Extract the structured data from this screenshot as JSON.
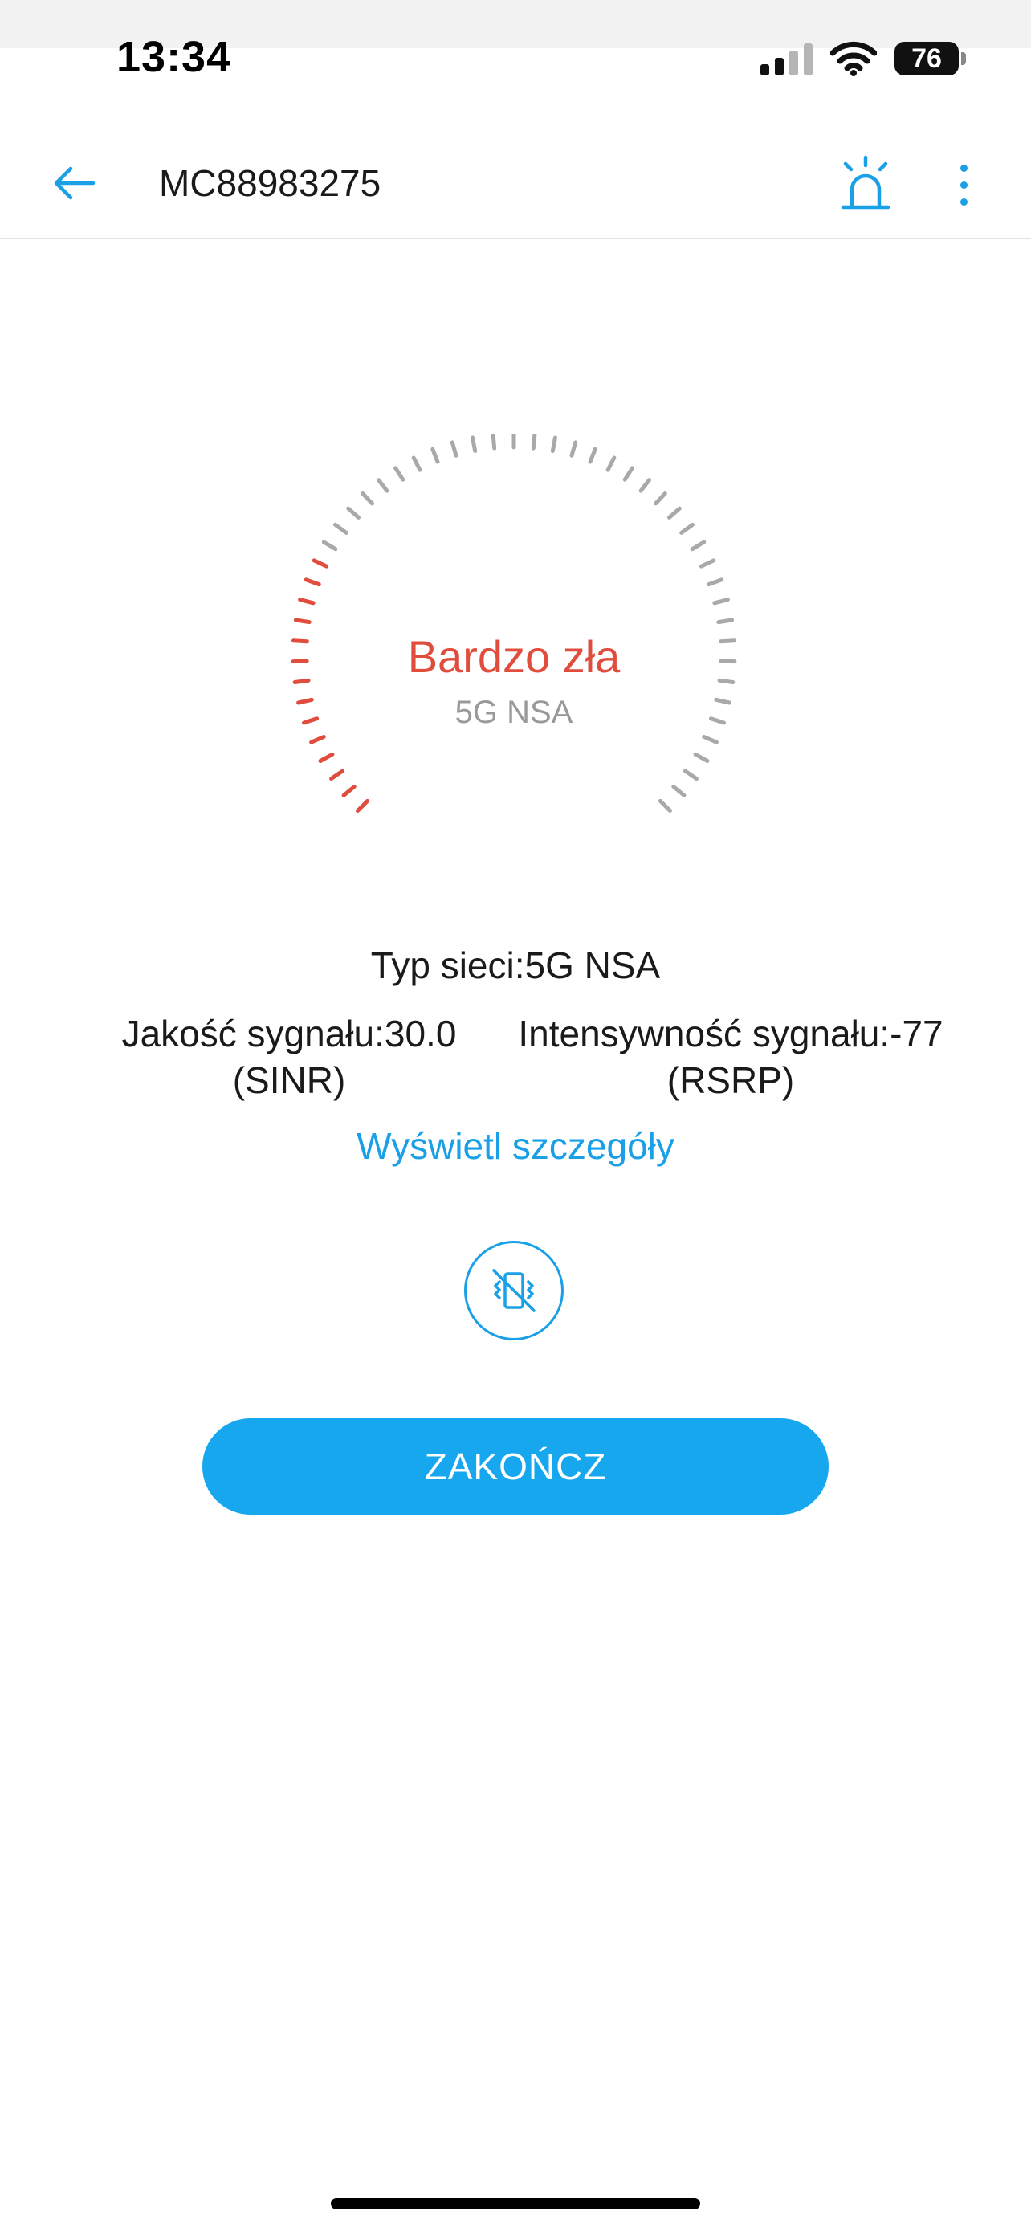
{
  "status_bar": {
    "time": "13:34",
    "battery_percent": "76",
    "signal_icon": "cellular-signal-icon",
    "wifi_icon": "wifi-icon",
    "battery_icon": "battery-icon"
  },
  "app_bar": {
    "title": "MC88983275",
    "back_icon": "arrow-left-icon",
    "alarm_icon": "alarm-siren-icon",
    "more_icon": "more-vertical-icon"
  },
  "gauge": {
    "status": "Bardzo zła",
    "network_type": "5G NSA",
    "level_fraction": 0.25,
    "active_color": "#e04d3d",
    "inactive_color": "#a9a9a9"
  },
  "info": {
    "network_line": "Typ sieci:5G NSA",
    "quality_line1": "Jakość sygnału:30.0",
    "quality_line2": "(SINR)",
    "intensity_line1": "Intensywność sygnału:-77",
    "intensity_line2": "(RSRP)",
    "details_link": "Wyświetl szczegóły"
  },
  "vibration_button": {
    "icon": "vibration-off-icon"
  },
  "finish_button": {
    "label": "ZAKOŃCZ"
  },
  "colors": {
    "accent": "#1aa0e6",
    "button": "#17a7ee",
    "bad": "#e04d3d"
  }
}
